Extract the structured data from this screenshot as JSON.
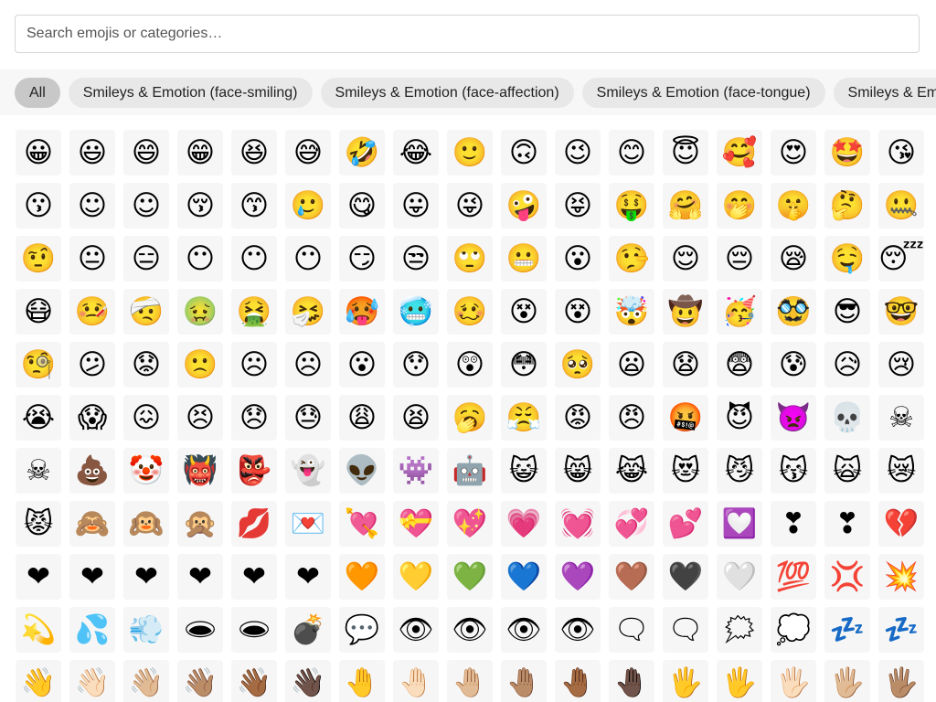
{
  "search": {
    "placeholder": "Search emojis or categories…",
    "value": ""
  },
  "filters": [
    {
      "label": "All",
      "active": true
    },
    {
      "label": "Smileys & Emotion (face-smiling)",
      "active": false
    },
    {
      "label": "Smileys & Emotion (face-affection)",
      "active": false
    },
    {
      "label": "Smileys & Emotion (face-tongue)",
      "active": false
    },
    {
      "label": "Smileys & Emo",
      "active": false
    }
  ],
  "emoji_rows": [
    [
      "😀",
      "😃",
      "😄",
      "😁",
      "😆",
      "😅",
      "🤣",
      "😂",
      "🙂",
      "🙃",
      "😉",
      "😊",
      "😇",
      "🥰",
      "😍",
      "🤩",
      "😘"
    ],
    [
      "😗",
      "☺",
      "☺",
      "😚",
      "😙",
      "🥲",
      "😋",
      "😛",
      "😜",
      "🤪",
      "😝",
      "🤑",
      "🤗",
      "🤭",
      "🤫",
      "🤔",
      "🤐"
    ],
    [
      "🤨",
      "😐",
      "😑",
      "😶",
      "😶",
      "😶",
      "😏",
      "😒",
      "🙄",
      "😬",
      "😮",
      "🤥",
      "😌",
      "😔",
      "😪",
      "🤤",
      "😴"
    ],
    [
      "😷",
      "🤒",
      "🤕",
      "🤢",
      "🤮",
      "🤧",
      "🥵",
      "🥶",
      "🥴",
      "😵",
      "😵",
      "🤯",
      "🤠",
      "🥳",
      "🥸",
      "😎",
      "🤓"
    ],
    [
      "🧐",
      "😕",
      "😟",
      "🙁",
      "☹",
      "☹",
      "😮",
      "😯",
      "😲",
      "😳",
      "🥺",
      "😦",
      "😧",
      "😨",
      "😰",
      "😥",
      "😢"
    ],
    [
      "😭",
      "😱",
      "😖",
      "😣",
      "😞",
      "😓",
      "😩",
      "😫",
      "🥱",
      "😤",
      "😡",
      "😠",
      "🤬",
      "😈",
      "👿",
      "💀",
      "☠"
    ],
    [
      "☠",
      "💩",
      "🤡",
      "👹",
      "👺",
      "👻",
      "👽",
      "👾",
      "🤖",
      "😺",
      "😸",
      "😹",
      "😻",
      "😼",
      "😽",
      "🙀",
      "😿"
    ],
    [
      "😾",
      "🙈",
      "🙉",
      "🙊",
      "💋",
      "💌",
      "💘",
      "💝",
      "💖",
      "💗",
      "💓",
      "💞",
      "💕",
      "💟",
      "❣",
      "❣",
      "💔"
    ],
    [
      "❤",
      "❤",
      "❤",
      "❤",
      "❤",
      "❤",
      "🧡",
      "💛",
      "💚",
      "💙",
      "💜",
      "🤎",
      "🖤",
      "🤍",
      "💯",
      "💢",
      "💥"
    ],
    [
      "💫",
      "💦",
      "💨",
      "🕳",
      "🕳",
      "💣",
      "💬",
      "👁",
      "👁",
      "👁",
      "👁",
      "🗨",
      "🗨",
      "🗯",
      "💭",
      "💤",
      "💤"
    ],
    [
      "👋",
      "👋🏻",
      "👋🏼",
      "👋🏽",
      "👋🏾",
      "👋🏿",
      "🤚",
      "🤚🏻",
      "🤚🏼",
      "🤚🏽",
      "🤚🏾",
      "🤚🏿",
      "🖐",
      "🖐",
      "🖐🏻",
      "🖐🏼",
      "🖐🏽"
    ]
  ]
}
